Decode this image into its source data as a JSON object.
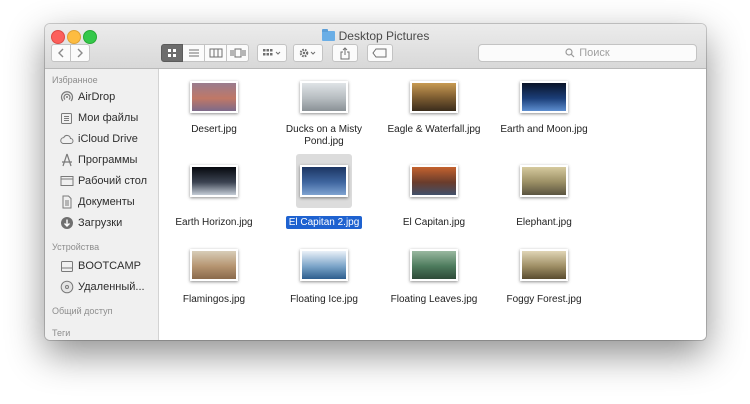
{
  "window": {
    "title": "Desktop Pictures",
    "search_placeholder": "Поиск"
  },
  "toolbar": {
    "views": [
      "icon-view",
      "list-view",
      "column-view",
      "cover-flow-view"
    ],
    "active_view": "icon-view",
    "icons": [
      "back-icon",
      "forward-icon",
      "arrange-icon",
      "action-gear-icon",
      "share-icon",
      "tag-icon",
      "search-icon"
    ]
  },
  "sidebar": {
    "favorites_header": "Избранное",
    "favorites": [
      {
        "label": "AirDrop",
        "icon": "airdrop-icon"
      },
      {
        "label": "Мои файлы",
        "icon": "all-files-icon"
      },
      {
        "label": "iCloud Drive",
        "icon": "cloud-icon"
      },
      {
        "label": "Программы",
        "icon": "applications-icon"
      },
      {
        "label": "Рабочий стол",
        "icon": "desktop-icon"
      },
      {
        "label": "Документы",
        "icon": "documents-icon"
      },
      {
        "label": "Загрузки",
        "icon": "downloads-icon"
      }
    ],
    "devices_header": "Устройства",
    "devices": [
      {
        "label": "BOOTCAMP",
        "icon": "disk-icon"
      },
      {
        "label": "Удаленный...",
        "icon": "remote-disc-icon"
      }
    ],
    "shared_header": "Общий доступ",
    "tags_header": "Теги"
  },
  "files": [
    {
      "name": "Desert.jpg",
      "colors": [
        "#9a7c8e",
        "#c07866",
        "#7d6a8a"
      ]
    },
    {
      "name": "Ducks on a Misty Pond.jpg",
      "colors": [
        "#dfe3e6",
        "#b6bcc0",
        "#8a9196"
      ]
    },
    {
      "name": "Eagle & Waterfall.jpg",
      "colors": [
        "#c89a52",
        "#7a5a30",
        "#3a2c1c"
      ]
    },
    {
      "name": "Earth and Moon.jpg",
      "colors": [
        "#0a1428",
        "#1b3e78",
        "#5d8ed0"
      ]
    },
    {
      "name": "Earth Horizon.jpg",
      "colors": [
        "#06080e",
        "#3c4452",
        "#c4ccd6"
      ]
    },
    {
      "name": "El Capitan 2.jpg",
      "colors": [
        "#1c3562",
        "#3f66a0",
        "#7fa3d1"
      ],
      "selected": true
    },
    {
      "name": "El Capitan.jpg",
      "colors": [
        "#c4622e",
        "#6a3c2c",
        "#41506a"
      ]
    },
    {
      "name": "Elephant.jpg",
      "colors": [
        "#d6ca9e",
        "#9a8e64",
        "#5a5440"
      ]
    },
    {
      "name": "Flamingos.jpg",
      "colors": [
        "#d8cdb8",
        "#b59470",
        "#8a6a4c"
      ]
    },
    {
      "name": "Floating Ice.jpg",
      "colors": [
        "#eaf1f8",
        "#7aa4c8",
        "#2e5e8e"
      ]
    },
    {
      "name": "Floating Leaves.jpg",
      "colors": [
        "#9ab8a0",
        "#4c7a5c",
        "#2e4a38"
      ]
    },
    {
      "name": "Foggy Forest.jpg",
      "colors": [
        "#e0d5b6",
        "#9e8e64",
        "#5a4c30"
      ]
    }
  ]
}
